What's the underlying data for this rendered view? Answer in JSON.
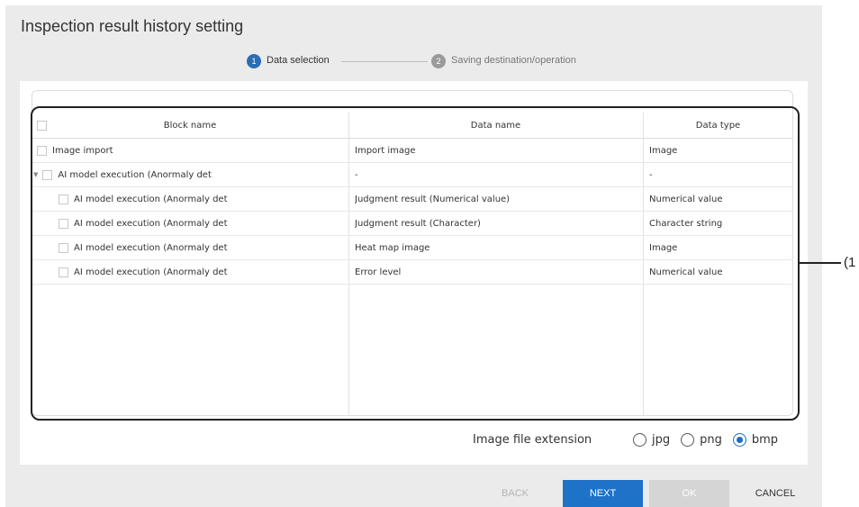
{
  "window": {
    "title": "Inspection result history setting"
  },
  "stepper": {
    "steps": [
      {
        "number": "1",
        "label": "Data selection",
        "state": "active"
      },
      {
        "number": "2",
        "label": "Saving destination/operation",
        "state": "inactive"
      }
    ]
  },
  "table": {
    "columns": [
      "Block name",
      "Data name",
      "Data type"
    ],
    "rows": [
      {
        "block": "Image import",
        "data_name": "Import image",
        "data_type": "Image",
        "level": 0,
        "expandable": false
      },
      {
        "block": "AI model execution (Anormaly det",
        "data_name": "-",
        "data_type": "-",
        "level": 0,
        "expandable": true
      },
      {
        "block": "AI model execution (Anormaly det",
        "data_name": "Judgment result (Numerical value)",
        "data_type": "Numerical value",
        "level": 1,
        "expandable": false
      },
      {
        "block": "AI model execution (Anormaly det",
        "data_name": "Judgment result (Character)",
        "data_type": "Character string",
        "level": 1,
        "expandable": false
      },
      {
        "block": "AI model execution (Anormaly det",
        "data_name": "Heat map image",
        "data_type": "Image",
        "level": 1,
        "expandable": false
      },
      {
        "block": "AI model execution (Anormaly det",
        "data_name": "Error level",
        "data_type": "Numerical value",
        "level": 1,
        "expandable": false
      }
    ]
  },
  "callout": {
    "label": "(1"
  },
  "image_extension": {
    "label": "Image file extension",
    "options": [
      "jpg",
      "png",
      "bmp"
    ],
    "selected": "bmp"
  },
  "footer": {
    "back_label": "BACK",
    "next_label": "NEXT",
    "ok_label": "OK",
    "cancel_label": "CANCEL"
  },
  "colors": {
    "accent": "#1e72c8",
    "step_active": "#2a6db5",
    "step_inactive": "#9a9a9a"
  }
}
